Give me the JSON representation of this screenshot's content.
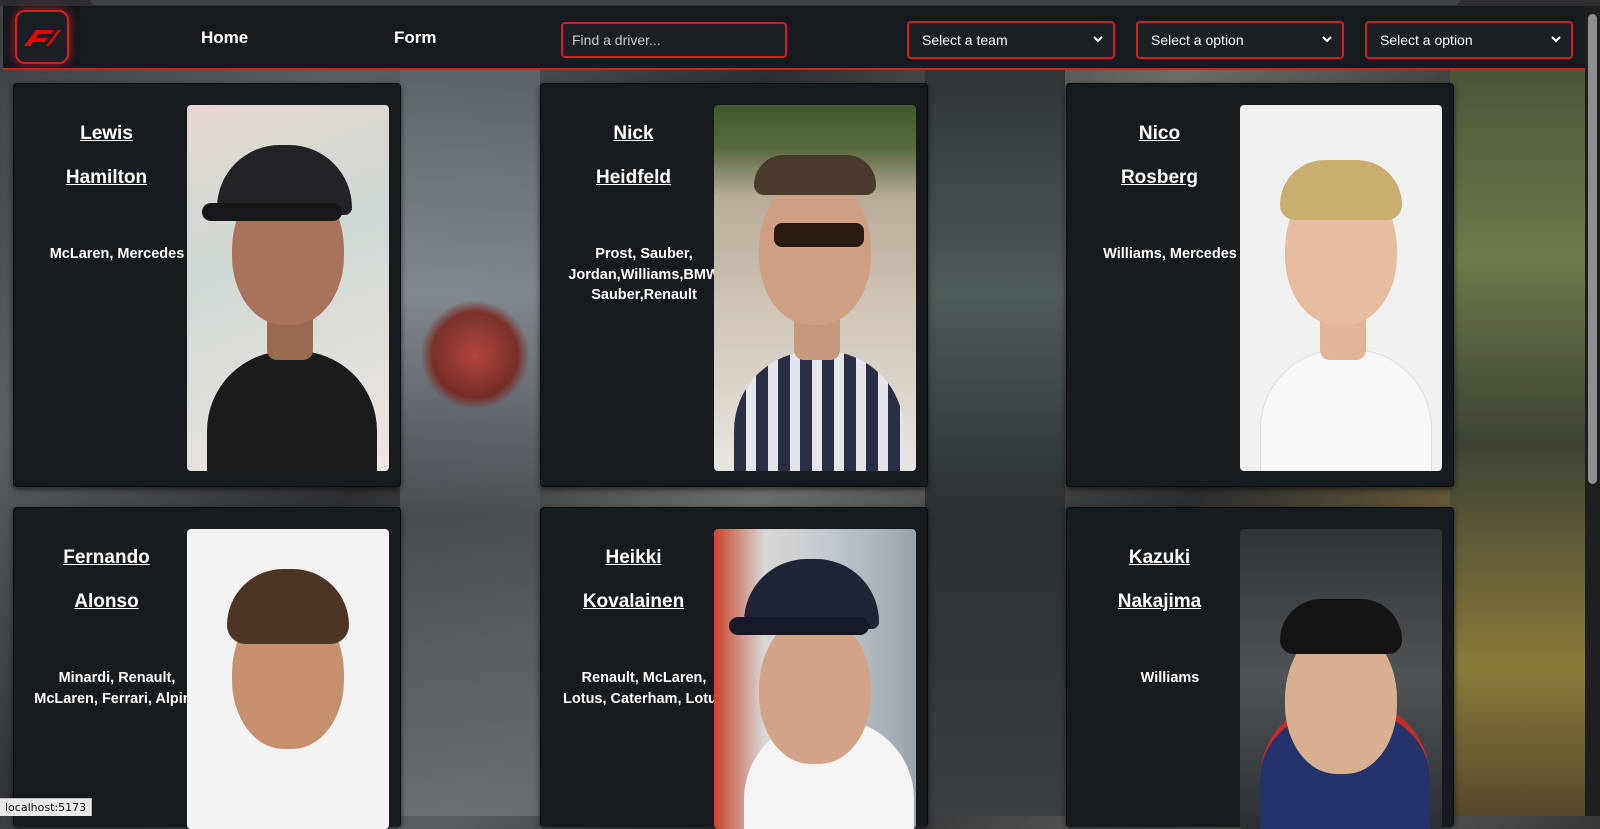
{
  "navbar": {
    "logo_alt": "F1",
    "links": [
      {
        "label": "Home"
      },
      {
        "label": "Form"
      }
    ],
    "search": {
      "placeholder": "Find a driver..."
    },
    "selects": [
      {
        "value": "Select a team"
      },
      {
        "value": "Select a option"
      },
      {
        "value": "Select a option"
      }
    ]
  },
  "drivers": [
    {
      "first": "Lewis",
      "last": "Hamilton",
      "teams": "McLaren, Mercedes"
    },
    {
      "first": "Nick",
      "last": "Heidfeld",
      "teams": "Prost, Sauber, Jordan,Williams,BMW Sauber,Renault"
    },
    {
      "first": "Nico",
      "last": "Rosberg",
      "teams": "Williams, Mercedes"
    },
    {
      "first": "Fernando",
      "last": "Alonso",
      "teams": "Minardi, Renault, McLaren, Ferrari, Alpine"
    },
    {
      "first": "Heikki",
      "last": "Kovalainen",
      "teams": "Renault, McLaren, Lotus, Caterham, Lotus"
    },
    {
      "first": "Kazuki",
      "last": "Nakajima",
      "teams": "Williams"
    }
  ],
  "status_bar": {
    "url": "localhost:5173"
  },
  "colors": {
    "accent": "#d91c1c",
    "card_bg": "#151b1e",
    "nav_bg": "#151a1e"
  }
}
